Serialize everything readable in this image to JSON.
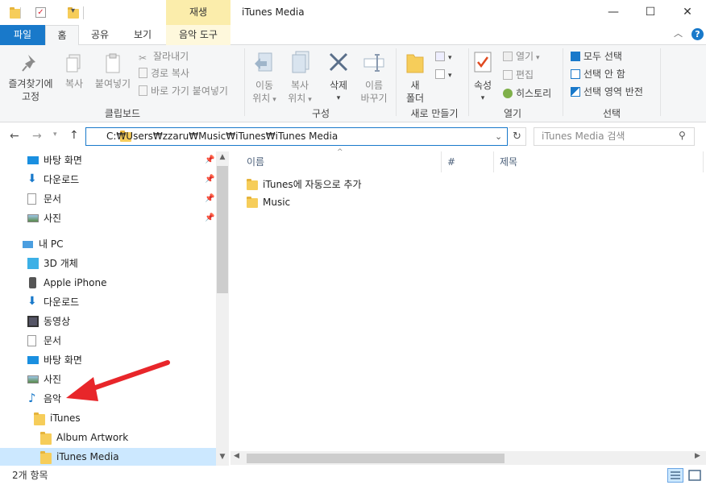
{
  "window": {
    "title": "iTunes Media",
    "context_tab_group": "재생",
    "minimize": "—",
    "maximize": "☐",
    "close": "✕"
  },
  "tabs": {
    "file": "파일",
    "home": "홈",
    "share": "공유",
    "view": "보기",
    "music_tools": "음악 도구"
  },
  "ribbon": {
    "clipboard": {
      "pin_label_1": "즐겨찾기에",
      "pin_label_2": "고정",
      "copy": "복사",
      "paste": "붙여넣기",
      "cut": "잘라내기",
      "copy_path": "경로 복사",
      "paste_shortcut": "바로 가기 붙여넣기",
      "group": "클립보드"
    },
    "organize": {
      "move_to_1": "이동",
      "move_to_2": "위치",
      "copy_to_1": "복사",
      "copy_to_2": "위치",
      "delete": "삭제",
      "rename_1": "이름",
      "rename_2": "바꾸기",
      "group": "구성"
    },
    "new": {
      "new_folder_1": "새",
      "new_folder_2": "폴더",
      "group": "새로 만들기"
    },
    "open": {
      "properties": "속성",
      "open": "열기",
      "edit": "편집",
      "history": "히스토리",
      "group": "열기"
    },
    "select": {
      "select_all": "모두 선택",
      "select_none": "선택 안 함",
      "invert": "선택 영역 반전",
      "group": "선택"
    }
  },
  "address": {
    "path": "C:₩Users₩zzaru₩Music₩iTunes₩iTunes Media",
    "search_placeholder": "iTunes Media 검색"
  },
  "nav_pane": {
    "quick_access": [
      {
        "label": "바탕 화면",
        "icon": "desktop-icon"
      },
      {
        "label": "다운로드",
        "icon": "download-icon"
      },
      {
        "label": "문서",
        "icon": "document-icon"
      },
      {
        "label": "사진",
        "icon": "pictures-icon"
      }
    ],
    "this_pc": "내 PC",
    "pc_items": [
      {
        "label": "3D 개체",
        "icon": "3d-objects-icon"
      },
      {
        "label": "Apple iPhone",
        "icon": "iphone-icon"
      },
      {
        "label": "다운로드",
        "icon": "download-icon"
      },
      {
        "label": "동영상",
        "icon": "videos-icon"
      },
      {
        "label": "문서",
        "icon": "document-icon"
      },
      {
        "label": "바탕 화면",
        "icon": "desktop-icon"
      },
      {
        "label": "사진",
        "icon": "pictures-icon"
      },
      {
        "label": "음악",
        "icon": "music-icon"
      }
    ],
    "music_tree": [
      {
        "label": "iTunes"
      },
      {
        "label": "Album Artwork"
      },
      {
        "label": "iTunes Media"
      }
    ]
  },
  "content": {
    "columns": [
      "이름",
      "#",
      "제목"
    ],
    "items": [
      {
        "name": "iTunes에 자동으로 추가"
      },
      {
        "name": "Music"
      }
    ]
  },
  "status": {
    "count": "2개 항목"
  },
  "colors": {
    "accent": "#1979ca",
    "context_tab": "#fbedab",
    "selection": "#cce8ff",
    "folder": "#f6cd5a",
    "annotation_arrow": "#e8262a"
  }
}
